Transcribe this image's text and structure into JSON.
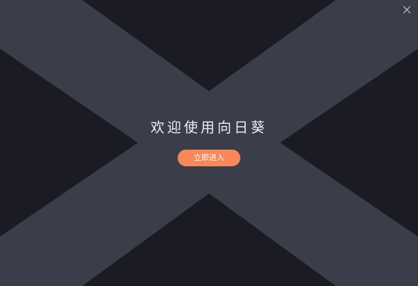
{
  "window": {
    "close_icon": "close-icon"
  },
  "welcome": {
    "title": "欢迎使用向日葵",
    "enter_label": "立即进入"
  },
  "colors": {
    "band": "#3a3e4a",
    "dark_triangle": "#1b1c23",
    "accent": "#f8875a",
    "title_text": "#eceef2",
    "close_icon": "#c8cbd2"
  }
}
